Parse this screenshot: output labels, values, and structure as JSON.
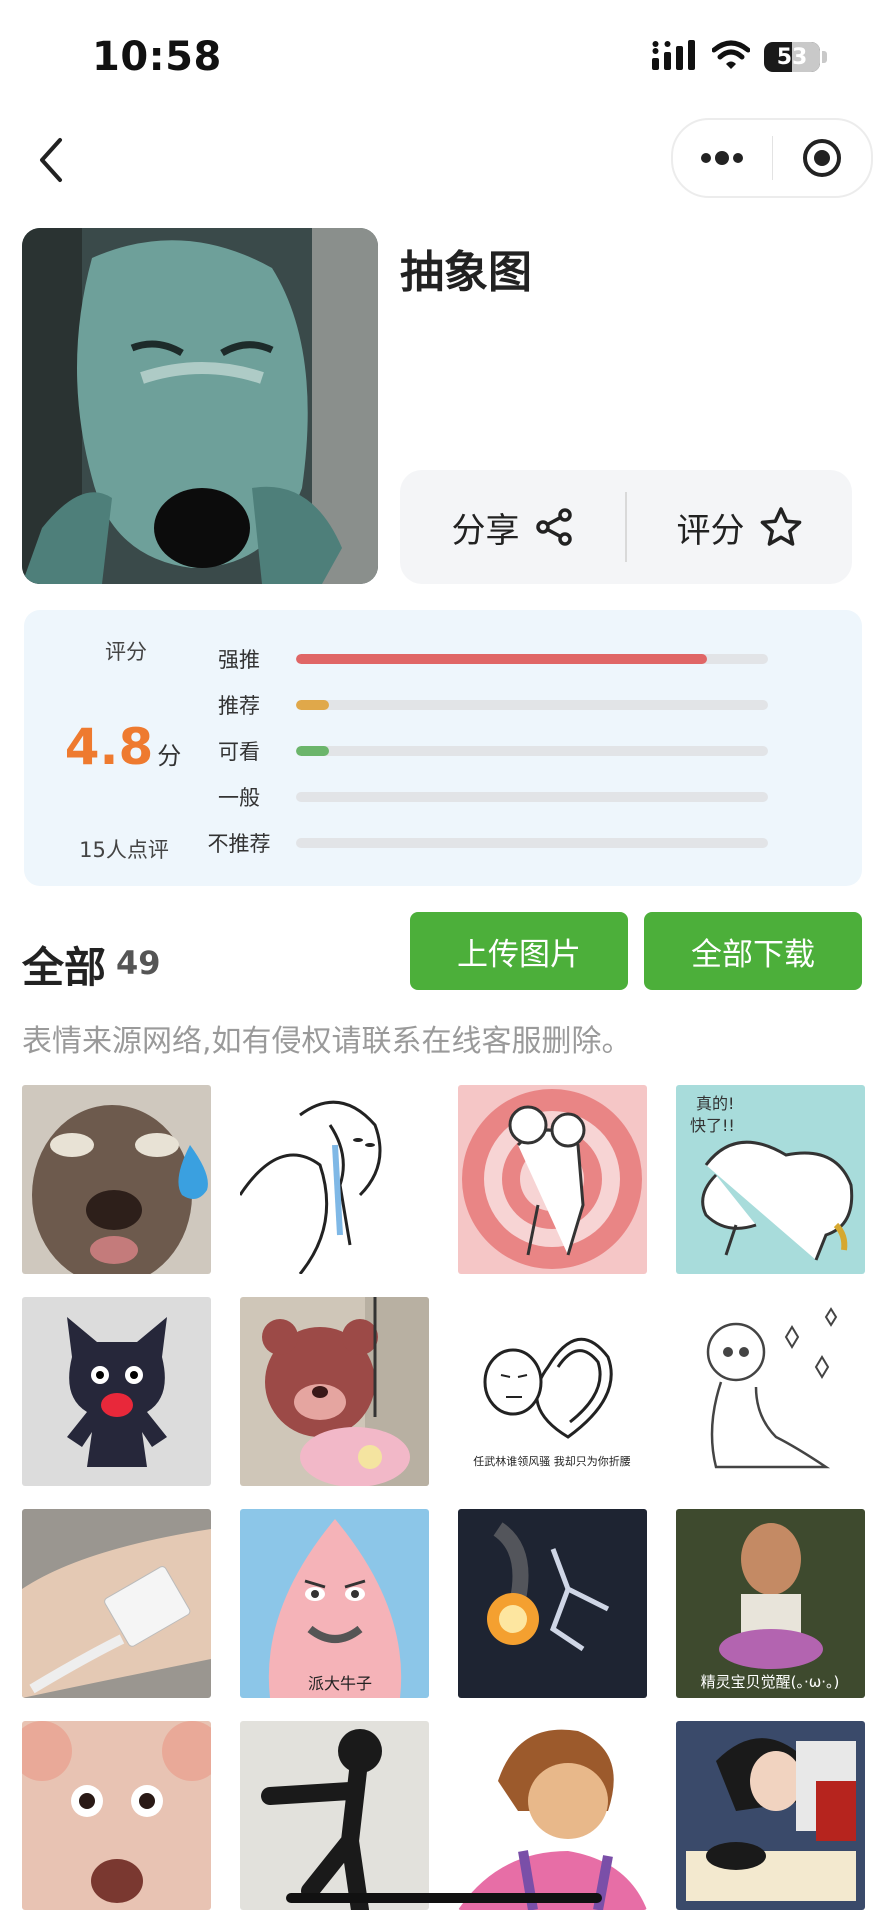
{
  "status_bar": {
    "time": "10:58",
    "battery": "53"
  },
  "header": {
    "title": "抽象图"
  },
  "actions": {
    "share_label": "分享",
    "rate_label": "评分"
  },
  "rating": {
    "label": "评分",
    "score": "4.8",
    "score_unit": "分",
    "count_text": "15人点评",
    "bars": [
      {
        "label": "强推",
        "fraction": 0.87,
        "color": "#e06666"
      },
      {
        "label": "推荐",
        "fraction": 0.07,
        "color": "#e0a84a"
      },
      {
        "label": "可看",
        "fraction": 0.07,
        "color": "#6bb56b"
      },
      {
        "label": "一般",
        "fraction": 0.0,
        "color": "#cccccc"
      },
      {
        "label": "不推荐",
        "fraction": 0.0,
        "color": "#cccccc"
      }
    ]
  },
  "gallery": {
    "title": "全部",
    "count": "49",
    "upload_label": "上传图片",
    "download_label": "全部下载",
    "notice": "表情来源网络,如有侵权请联系在线客服删除。",
    "tiles": [
      {
        "name": "crying-dog-meme",
        "caption": ""
      },
      {
        "name": "drooling-sketch-meme",
        "caption": ""
      },
      {
        "name": "bear-hug-target-meme",
        "caption": ""
      },
      {
        "name": "fast-dog-meme",
        "caption": "真的!快了!!"
      },
      {
        "name": "black-cat-doll-meme",
        "caption": ""
      },
      {
        "name": "lotso-bear-meme",
        "caption": ""
      },
      {
        "name": "heart-face-meme",
        "caption": "任武林谁领风骚 我却只为你折腰"
      },
      {
        "name": "sitting-sketch-meme",
        "caption": ""
      },
      {
        "name": "hand-tag-meme",
        "caption": ""
      },
      {
        "name": "patrick-meme",
        "caption": "派大牛子"
      },
      {
        "name": "fire-dancer-meme",
        "caption": ""
      },
      {
        "name": "fairy-awaken-meme",
        "caption": "精灵宝贝觉醒(。·ω·。)"
      },
      {
        "name": "pig-face-meme",
        "caption": ""
      },
      {
        "name": "shadow-figure-meme",
        "caption": ""
      },
      {
        "name": "dora-meme",
        "caption": ""
      },
      {
        "name": "snow-white-meme",
        "caption": ""
      }
    ]
  }
}
